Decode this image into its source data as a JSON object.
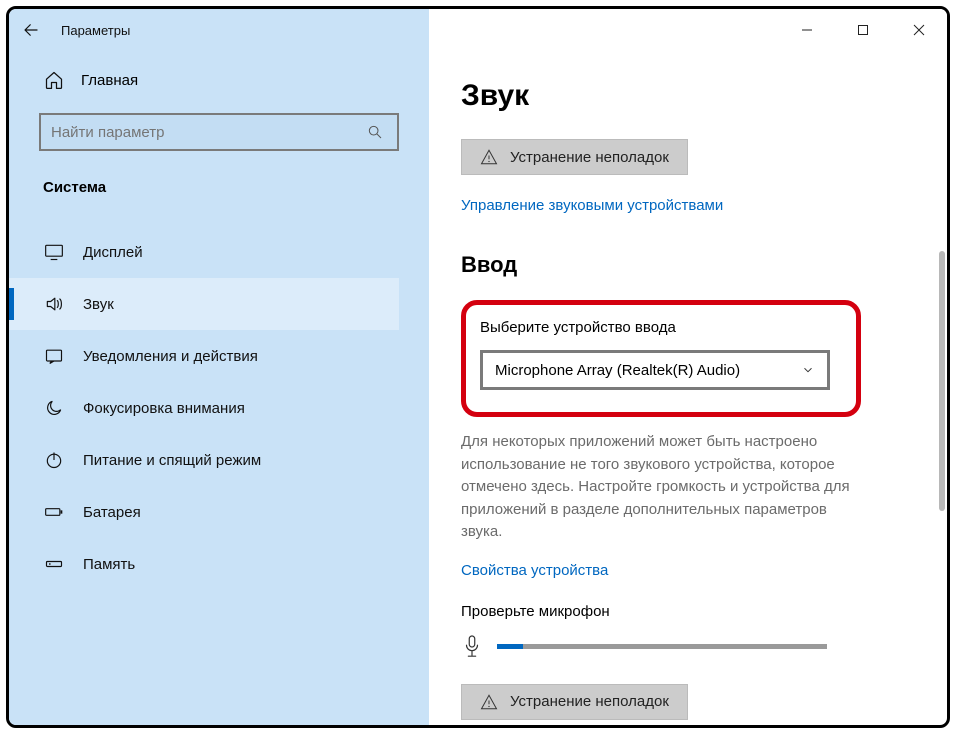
{
  "window": {
    "title": "Параметры"
  },
  "sidebar": {
    "home": "Главная",
    "search_placeholder": "Найти параметр",
    "category": "Система",
    "items": [
      {
        "label": "Дисплей"
      },
      {
        "label": "Звук"
      },
      {
        "label": "Уведомления и действия"
      },
      {
        "label": "Фокусировка внимания"
      },
      {
        "label": "Питание и спящий режим"
      },
      {
        "label": "Батарея"
      },
      {
        "label": "Память"
      }
    ]
  },
  "main": {
    "heading": "Звук",
    "troubleshoot": "Устранение неполадок",
    "manage_devices_link": "Управление звуковыми устройствами",
    "input_heading": "Ввод",
    "input_device_label": "Выберите устройство ввода",
    "input_device_value": "Microphone Array (Realtek(R) Audio)",
    "note": "Для некоторых приложений может быть настроено использование не того звукового устройства, которое отмечено здесь. Настройте громкость и устройства для приложений в разделе дополнительных параметров звука.",
    "device_props_link": "Свойства устройства",
    "test_mic_label": "Проверьте микрофон",
    "troubleshoot2": "Устранение неполадок"
  }
}
